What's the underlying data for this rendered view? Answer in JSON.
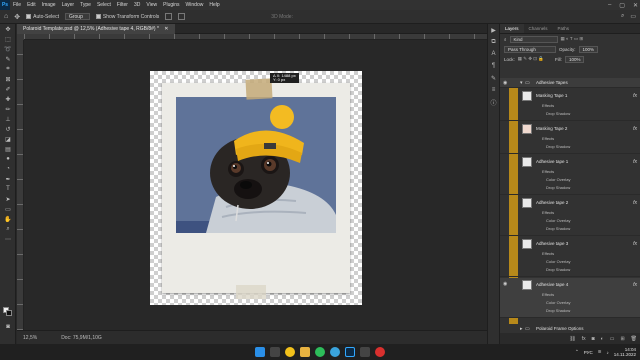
{
  "menu": {
    "logo": "Ps",
    "items": [
      "File",
      "Edit",
      "Image",
      "Layer",
      "Type",
      "Select",
      "Filter",
      "3D",
      "View",
      "Plugins",
      "Window",
      "Help"
    ]
  },
  "options": {
    "auto_select_label": "Auto-Select",
    "auto_select_value": "Group",
    "show_transform_label": "Show Transform Controls",
    "mode_3d": "3D Mode:"
  },
  "document": {
    "tab_title": "Polaroid Template.psd @ 12,5% (Adhesive tape 4, RGB/8#) *",
    "tooltip_line1": "Δ X: 1488 px",
    "tooltip_line2": "Y: 0 px"
  },
  "status": {
    "zoom": "12,5%",
    "doc_info": "Doc: 75,9M/1,10G"
  },
  "panel": {
    "tabs": [
      "Layers",
      "Channels",
      "Paths"
    ],
    "filter_label": "Kind",
    "blend_mode": "Pass Through",
    "opacity_label": "Opacity:",
    "opacity_value": "100%",
    "lock_label": "Lock:",
    "fill_label": "Fill:",
    "fill_value": "100%",
    "group_name": "Adhesive Tapes",
    "bottom_group": "Polaroid Frame Options",
    "layers": [
      {
        "name": "Masking Tape 1",
        "effects": [
          "Effects",
          "Drop Shadow"
        ]
      },
      {
        "name": "Masking Tape 2",
        "effects": [
          "Effects",
          "Drop Shadow"
        ]
      },
      {
        "name": "Adhesive tape 1",
        "effects": [
          "Effects",
          "Color Overlay",
          "Drop Shadow"
        ]
      },
      {
        "name": "Adhesive tape 2",
        "effects": [
          "Effects",
          "Color Overlay",
          "Drop Shadow"
        ]
      },
      {
        "name": "Adhesive tape 3",
        "effects": [
          "Effects",
          "Color Overlay",
          "Drop Shadow"
        ]
      },
      {
        "name": "Adhesive tape 4",
        "effects": [
          "Effects",
          "Color Overlay",
          "Drop Shadow"
        ]
      }
    ]
  },
  "taskbar": {
    "lang": "РУС",
    "time": "14:04",
    "date": "14.11.2022"
  },
  "colors": {
    "accent_gold": "#b7891a",
    "ps_blue": "#31a8ff"
  }
}
